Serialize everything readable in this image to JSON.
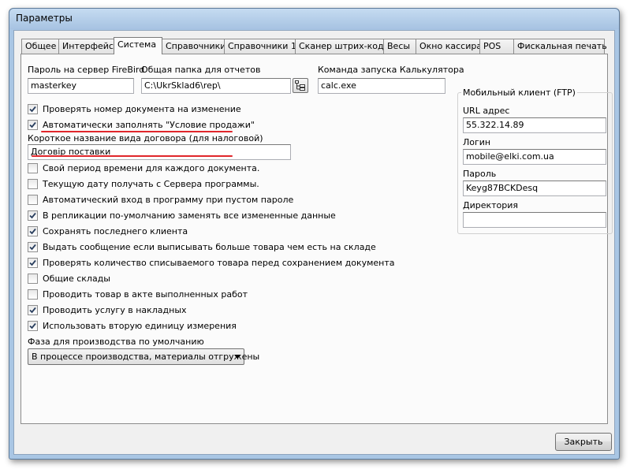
{
  "window": {
    "title": "Параметры"
  },
  "tabs": [
    {
      "label": "Общее",
      "active": false
    },
    {
      "label": "Интерфейс",
      "active": false
    },
    {
      "label": "Система",
      "active": true
    },
    {
      "label": "Справочники",
      "active": false
    },
    {
      "label": "Справочники 1",
      "active": false
    },
    {
      "label": "Сканер штрих-кодов",
      "active": false
    },
    {
      "label": "Весы",
      "active": false
    },
    {
      "label": "Окно кассира",
      "active": false
    },
    {
      "label": "POS",
      "active": false
    },
    {
      "label": "Фискальная печать",
      "active": false
    }
  ],
  "system": {
    "firebird_password_label": "Пароль на сервер FireBird",
    "firebird_password_value": "masterkey",
    "reports_folder_label": "Общая папка для отчетов",
    "reports_folder_value": "C:\\UkrSklad6\\rep\\",
    "calculator_command_label": "Команда запуска Калькулятора",
    "calculator_command_value": "calc.exe",
    "contract_short_name_label": "Короткое название вида договора (для налоговой)",
    "contract_short_name_value": "Договір поставки",
    "checkboxes": [
      {
        "label": "Проверять номер документа на изменение",
        "checked": true
      },
      {
        "label": "Автоматически заполнять \"Условие продажи\"",
        "checked": true
      },
      {
        "label": "Свой период времени для каждого документа.",
        "checked": false
      },
      {
        "label": "Текущую дату получать с Сервера программы.",
        "checked": false
      },
      {
        "label": "Автоматический вход в программу при пустом пароле",
        "checked": false
      },
      {
        "label": "В репликации по-умолчанию заменять все измененные данные",
        "checked": true
      },
      {
        "label": "Сохранять последнего клиента",
        "checked": true
      },
      {
        "label": "Выдать сообщение если выписывать больше товара чем есть на складе",
        "checked": true
      },
      {
        "label": "Проверять количество списываемого товара перед сохранением документа",
        "checked": true
      },
      {
        "label": "Общие склады",
        "checked": false
      },
      {
        "label": "Проводить товар в акте выполненных работ",
        "checked": false
      },
      {
        "label": "Проводить услугу в накладных",
        "checked": true
      },
      {
        "label": "Использовать вторую единицу измерения",
        "checked": true
      }
    ],
    "production_phase_label": "Фаза для производства по умолчанию",
    "production_phase_value": "В процессе производства, материалы отгружены"
  },
  "mobile_client": {
    "title": "Мобильный клиент (FTP)",
    "url_label": "URL адрес",
    "url_value": "55.322.14.89",
    "login_label": "Логин",
    "login_value": "mobile@elki.com.ua",
    "password_label": "Пароль",
    "password_value": "Keyg87BCKDesq",
    "directory_label": "Директория",
    "directory_value": ""
  },
  "buttons": {
    "close_label": "Закрыть"
  },
  "colors": {
    "titlebar": "#a7c3e2",
    "panel": "#fbfbfb",
    "annotation_underline": "#e0262b"
  }
}
